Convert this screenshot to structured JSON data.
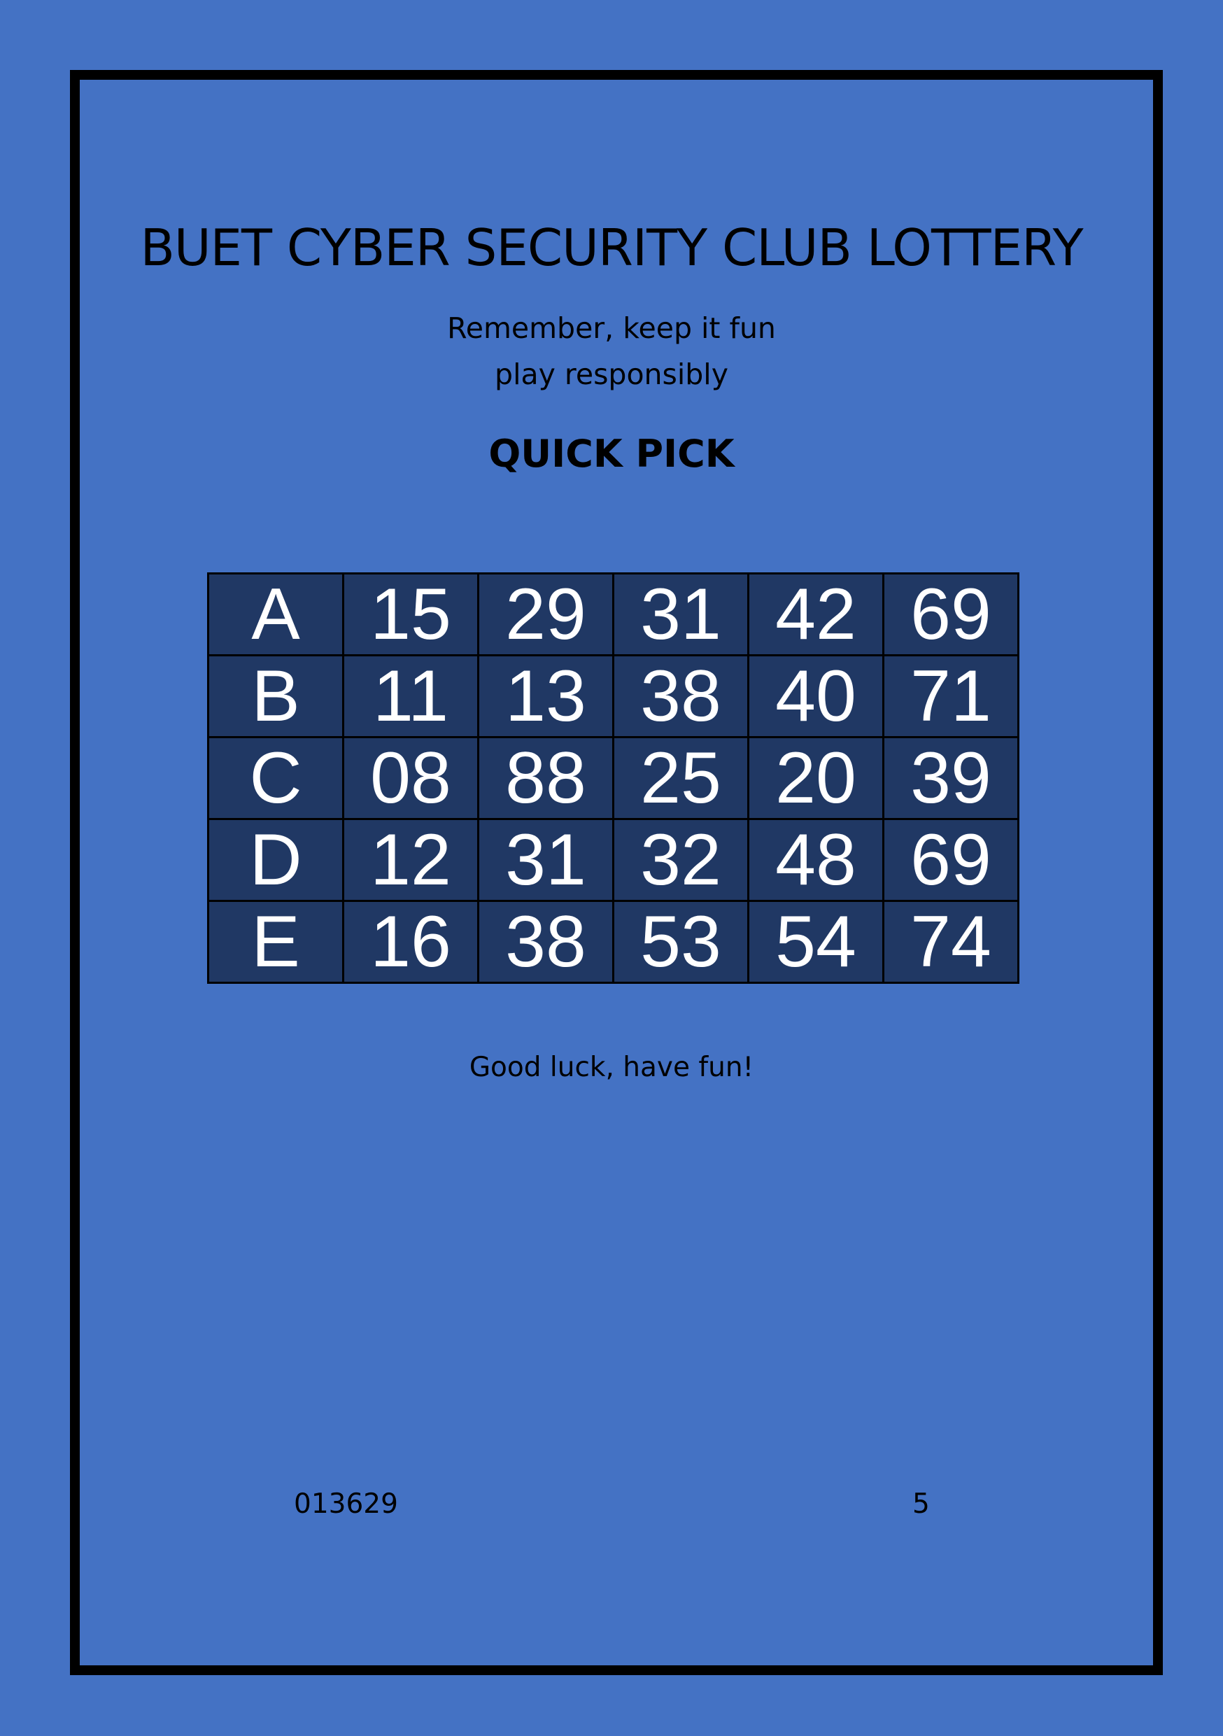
{
  "ticket": {
    "title": "BUET CYBER SECURITY CLUB LOTTERY",
    "subtitle_line1": "Remember, keep it fun",
    "subtitle_line2": "play responsibly",
    "mode": "QUICK PICK",
    "closing": "Good luck, have fun!",
    "serial": "013629",
    "page_number": "5"
  },
  "rows": [
    {
      "label": "A",
      "numbers": [
        "15",
        "29",
        "31",
        "42",
        "69"
      ]
    },
    {
      "label": "B",
      "numbers": [
        "11",
        "13",
        "38",
        "40",
        "71"
      ]
    },
    {
      "label": "C",
      "numbers": [
        "08",
        "88",
        "25",
        "20",
        "39"
      ]
    },
    {
      "label": "D",
      "numbers": [
        "12",
        "31",
        "32",
        "48",
        "69"
      ]
    },
    {
      "label": "E",
      "numbers": [
        "16",
        "38",
        "53",
        "54",
        "74"
      ]
    }
  ],
  "colors": {
    "page_background": "#4472c4",
    "cell_background": "#203864",
    "cell_text": "#ffffff",
    "border": "#000000"
  }
}
